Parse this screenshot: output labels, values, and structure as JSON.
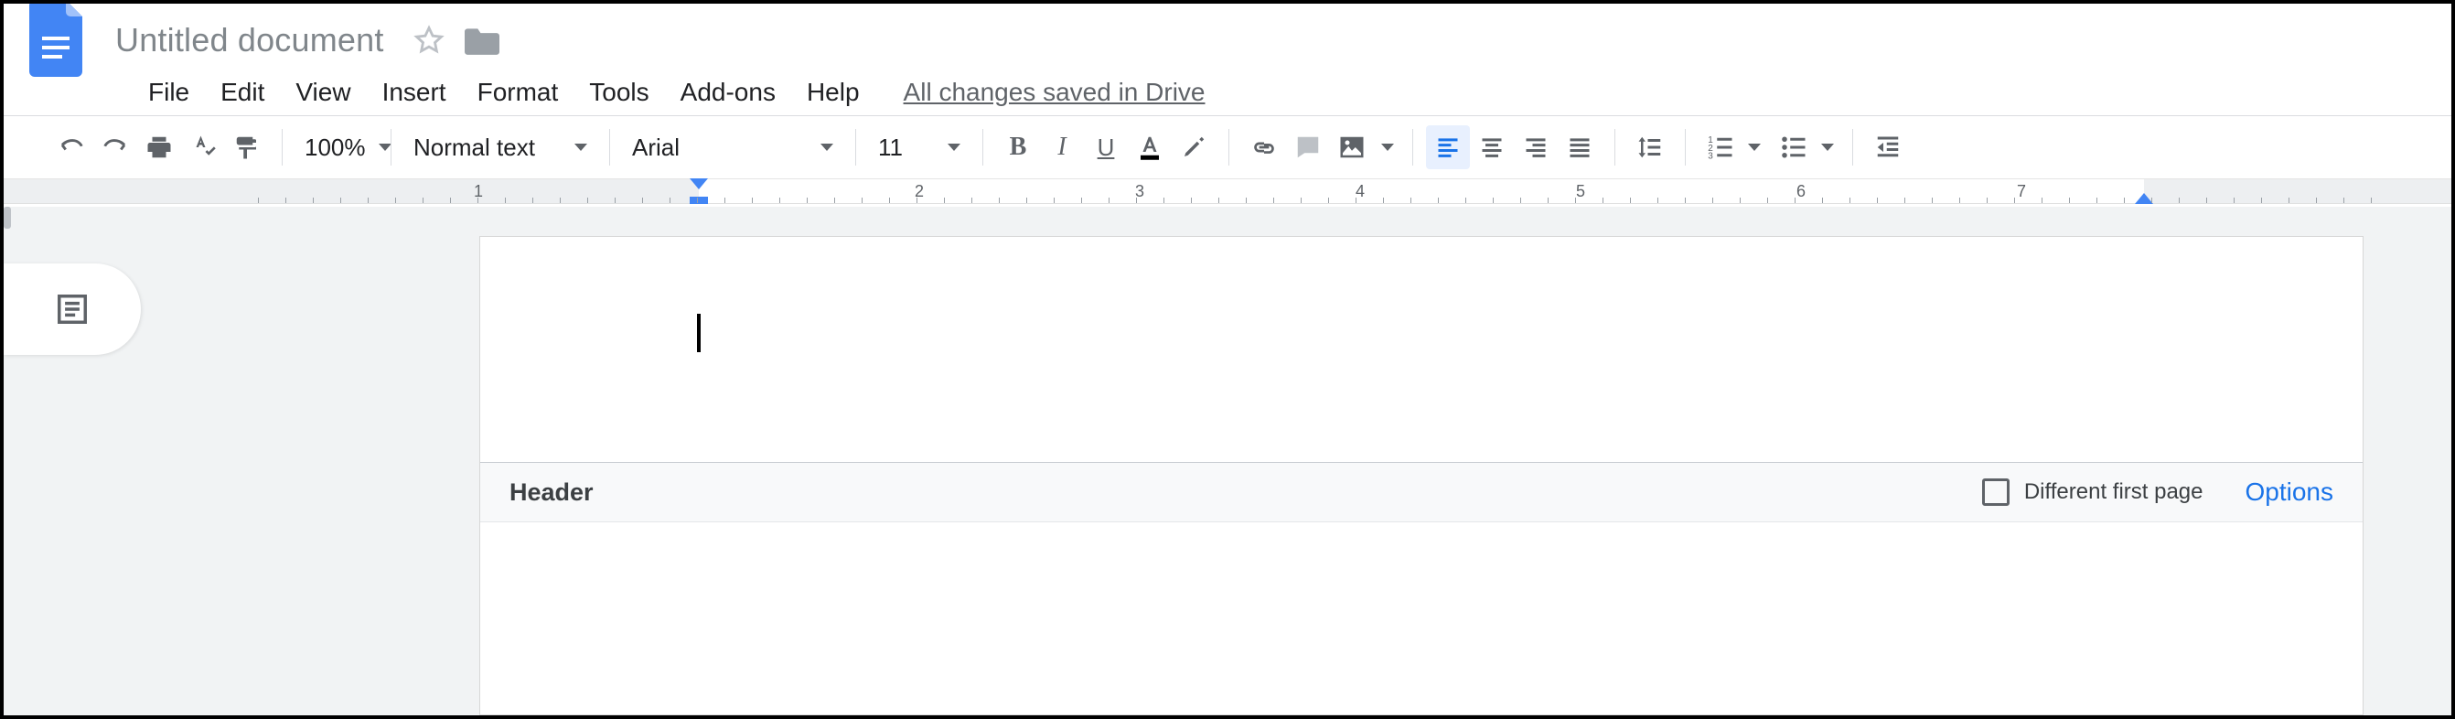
{
  "doc": {
    "title": "Untitled document",
    "save_status": "All changes saved in Drive"
  },
  "menu": {
    "items": [
      "File",
      "Edit",
      "View",
      "Insert",
      "Format",
      "Tools",
      "Add-ons",
      "Help"
    ]
  },
  "toolbar": {
    "zoom": "100%",
    "styles": "Normal text",
    "font": "Arial",
    "font_size": "11"
  },
  "ruler": {
    "numbers": [
      "1",
      "2",
      "3",
      "4",
      "5",
      "6",
      "7"
    ]
  },
  "header": {
    "label": "Header",
    "different_first_page": "Different first page",
    "options": "Options"
  }
}
